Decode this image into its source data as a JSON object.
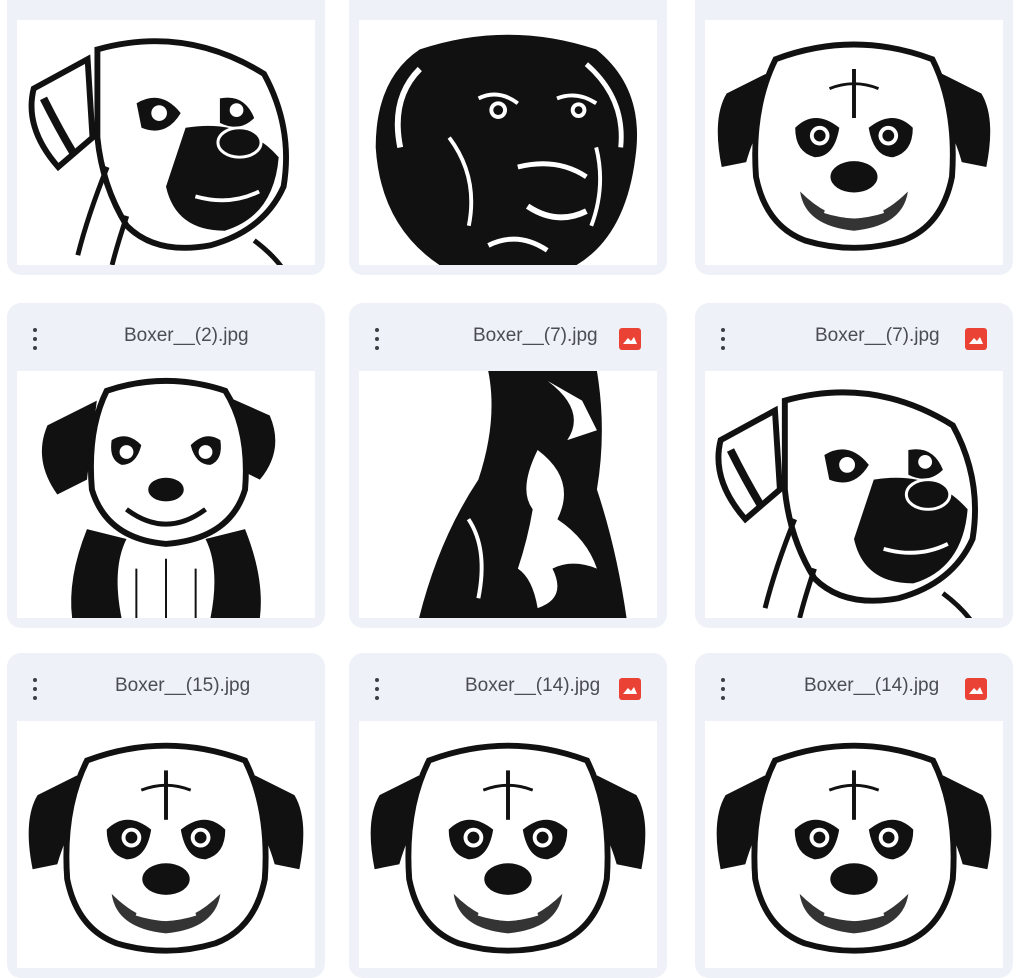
{
  "accent": {
    "image_icon_color": "#ea4335",
    "card_bg": "#eef1f7"
  },
  "files": [
    {
      "name": "",
      "icon": "none",
      "subject": "boxer-head-three-quarter"
    },
    {
      "name": "",
      "icon": "none",
      "subject": "boxer-head-dark"
    },
    {
      "name": "",
      "icon": "none",
      "subject": "boxer-head-front"
    },
    {
      "name": "Boxer__(2).jpg",
      "icon": "none",
      "subject": "boxer-puppy-bust"
    },
    {
      "name": "Boxer__(7).jpg",
      "icon": "image-icon",
      "subject": "boxer-neck-closeup"
    },
    {
      "name": "Boxer__(7).jpg",
      "icon": "image-icon",
      "subject": "boxer-head-three-quarter"
    },
    {
      "name": "Boxer__(15).jpg",
      "icon": "none",
      "subject": "boxer-head-front"
    },
    {
      "name": "Boxer__(14).jpg",
      "icon": "image-icon",
      "subject": "boxer-head-front-light"
    },
    {
      "name": "Boxer__(14).jpg",
      "icon": "image-icon",
      "subject": "boxer-head-front"
    }
  ]
}
